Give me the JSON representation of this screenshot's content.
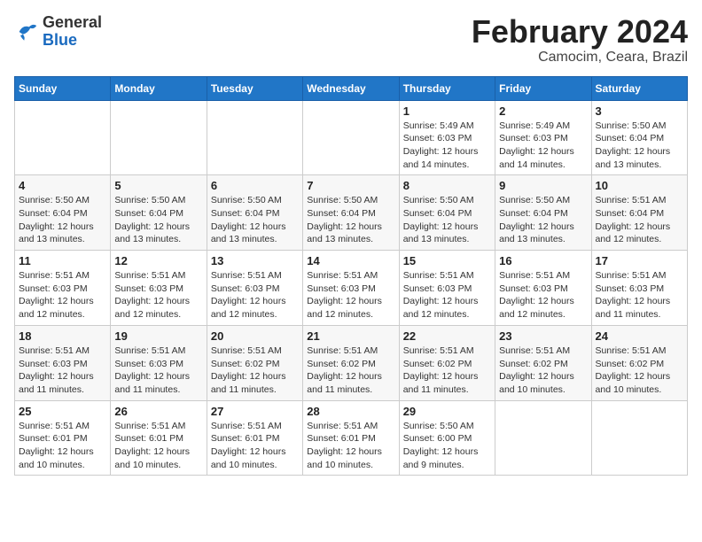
{
  "header": {
    "logo_general": "General",
    "logo_blue": "Blue",
    "title": "February 2024",
    "location": "Camocim, Ceara, Brazil"
  },
  "days_of_week": [
    "Sunday",
    "Monday",
    "Tuesday",
    "Wednesday",
    "Thursday",
    "Friday",
    "Saturday"
  ],
  "weeks": [
    [
      {
        "day": "",
        "info": ""
      },
      {
        "day": "",
        "info": ""
      },
      {
        "day": "",
        "info": ""
      },
      {
        "day": "",
        "info": ""
      },
      {
        "day": "1",
        "info": "Sunrise: 5:49 AM\nSunset: 6:03 PM\nDaylight: 12 hours\nand 14 minutes."
      },
      {
        "day": "2",
        "info": "Sunrise: 5:49 AM\nSunset: 6:03 PM\nDaylight: 12 hours\nand 14 minutes."
      },
      {
        "day": "3",
        "info": "Sunrise: 5:50 AM\nSunset: 6:04 PM\nDaylight: 12 hours\nand 13 minutes."
      }
    ],
    [
      {
        "day": "4",
        "info": "Sunrise: 5:50 AM\nSunset: 6:04 PM\nDaylight: 12 hours\nand 13 minutes."
      },
      {
        "day": "5",
        "info": "Sunrise: 5:50 AM\nSunset: 6:04 PM\nDaylight: 12 hours\nand 13 minutes."
      },
      {
        "day": "6",
        "info": "Sunrise: 5:50 AM\nSunset: 6:04 PM\nDaylight: 12 hours\nand 13 minutes."
      },
      {
        "day": "7",
        "info": "Sunrise: 5:50 AM\nSunset: 6:04 PM\nDaylight: 12 hours\nand 13 minutes."
      },
      {
        "day": "8",
        "info": "Sunrise: 5:50 AM\nSunset: 6:04 PM\nDaylight: 12 hours\nand 13 minutes."
      },
      {
        "day": "9",
        "info": "Sunrise: 5:50 AM\nSunset: 6:04 PM\nDaylight: 12 hours\nand 13 minutes."
      },
      {
        "day": "10",
        "info": "Sunrise: 5:51 AM\nSunset: 6:04 PM\nDaylight: 12 hours\nand 12 minutes."
      }
    ],
    [
      {
        "day": "11",
        "info": "Sunrise: 5:51 AM\nSunset: 6:03 PM\nDaylight: 12 hours\nand 12 minutes."
      },
      {
        "day": "12",
        "info": "Sunrise: 5:51 AM\nSunset: 6:03 PM\nDaylight: 12 hours\nand 12 minutes."
      },
      {
        "day": "13",
        "info": "Sunrise: 5:51 AM\nSunset: 6:03 PM\nDaylight: 12 hours\nand 12 minutes."
      },
      {
        "day": "14",
        "info": "Sunrise: 5:51 AM\nSunset: 6:03 PM\nDaylight: 12 hours\nand 12 minutes."
      },
      {
        "day": "15",
        "info": "Sunrise: 5:51 AM\nSunset: 6:03 PM\nDaylight: 12 hours\nand 12 minutes."
      },
      {
        "day": "16",
        "info": "Sunrise: 5:51 AM\nSunset: 6:03 PM\nDaylight: 12 hours\nand 12 minutes."
      },
      {
        "day": "17",
        "info": "Sunrise: 5:51 AM\nSunset: 6:03 PM\nDaylight: 12 hours\nand 11 minutes."
      }
    ],
    [
      {
        "day": "18",
        "info": "Sunrise: 5:51 AM\nSunset: 6:03 PM\nDaylight: 12 hours\nand 11 minutes."
      },
      {
        "day": "19",
        "info": "Sunrise: 5:51 AM\nSunset: 6:03 PM\nDaylight: 12 hours\nand 11 minutes."
      },
      {
        "day": "20",
        "info": "Sunrise: 5:51 AM\nSunset: 6:02 PM\nDaylight: 12 hours\nand 11 minutes."
      },
      {
        "day": "21",
        "info": "Sunrise: 5:51 AM\nSunset: 6:02 PM\nDaylight: 12 hours\nand 11 minutes."
      },
      {
        "day": "22",
        "info": "Sunrise: 5:51 AM\nSunset: 6:02 PM\nDaylight: 12 hours\nand 11 minutes."
      },
      {
        "day": "23",
        "info": "Sunrise: 5:51 AM\nSunset: 6:02 PM\nDaylight: 12 hours\nand 10 minutes."
      },
      {
        "day": "24",
        "info": "Sunrise: 5:51 AM\nSunset: 6:02 PM\nDaylight: 12 hours\nand 10 minutes."
      }
    ],
    [
      {
        "day": "25",
        "info": "Sunrise: 5:51 AM\nSunset: 6:01 PM\nDaylight: 12 hours\nand 10 minutes."
      },
      {
        "day": "26",
        "info": "Sunrise: 5:51 AM\nSunset: 6:01 PM\nDaylight: 12 hours\nand 10 minutes."
      },
      {
        "day": "27",
        "info": "Sunrise: 5:51 AM\nSunset: 6:01 PM\nDaylight: 12 hours\nand 10 minutes."
      },
      {
        "day": "28",
        "info": "Sunrise: 5:51 AM\nSunset: 6:01 PM\nDaylight: 12 hours\nand 10 minutes."
      },
      {
        "day": "29",
        "info": "Sunrise: 5:50 AM\nSunset: 6:00 PM\nDaylight: 12 hours\nand 9 minutes."
      },
      {
        "day": "",
        "info": ""
      },
      {
        "day": "",
        "info": ""
      }
    ]
  ]
}
